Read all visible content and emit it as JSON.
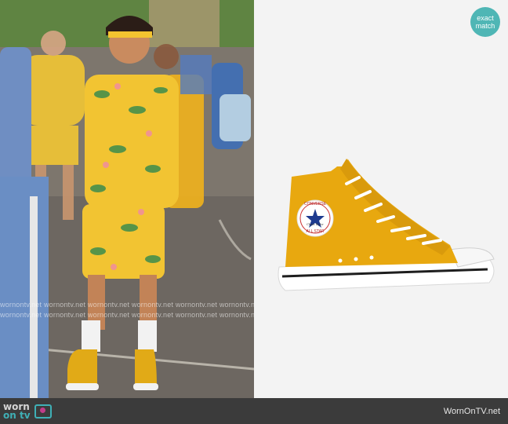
{
  "badge": {
    "line1": "exact",
    "line2": "match"
  },
  "watermark": {
    "row1": "wornontv.net  wornontv.net  wornontv.net  wornontv.net  wornontv.net  wornontv.net",
    "row2": "wornontv.net  wornontv.net  wornontv.net  wornontv.net  wornontv.net  wornontv.net"
  },
  "footer": {
    "logo_worn": "worn",
    "logo_on": "on tv",
    "site": "WornOnTV.net"
  },
  "product": {
    "patch_top": "CONVERSE",
    "patch_bottom": "ALL STAR",
    "patch_script": "Chuck Taylor"
  },
  "colors": {
    "shoe_yellow": "#e8a80f",
    "badge": "#4fb6b5",
    "footer_bg": "#3b3b3b",
    "accent_teal": "#3fb0b6"
  }
}
